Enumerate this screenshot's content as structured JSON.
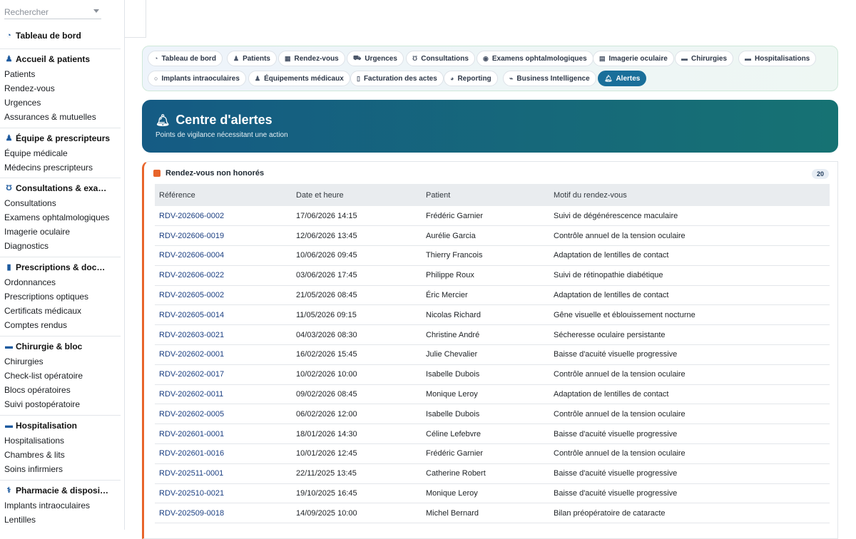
{
  "sidebar": {
    "search_placeholder": "Rechercher",
    "dashboard": "Tableau de bord",
    "sections": [
      {
        "title": "Accueil & patients",
        "icon": "user-icon",
        "items": [
          "Patients",
          "Rendez-vous",
          "Urgences",
          "Assurances & mutuelles"
        ]
      },
      {
        "title": "Équipe & prescripteurs",
        "icon": "team-icon",
        "items": [
          "Équipe médicale",
          "Médecins prescripteurs"
        ]
      },
      {
        "title": "Consultations & exa…",
        "icon": "stethoscope-icon",
        "items": [
          "Consultations",
          "Examens ophtalmologiques",
          "Imagerie oculaire",
          "Diagnostics"
        ]
      },
      {
        "title": "Prescriptions & doc…",
        "icon": "document-icon",
        "items": [
          "Ordonnances",
          "Prescriptions optiques",
          "Certificats médicaux",
          "Comptes rendus"
        ]
      },
      {
        "title": "Chirurgie & bloc",
        "icon": "bed-icon",
        "items": [
          "Chirurgies",
          "Check-list opératoire",
          "Blocs opératoires",
          "Suivi postopératoire"
        ]
      },
      {
        "title": "Hospitalisation",
        "icon": "hospital-bed-icon",
        "items": [
          "Hospitalisations",
          "Chambres & lits",
          "Soins infirmiers"
        ]
      },
      {
        "title": "Pharmacie & disposi…",
        "icon": "pharmacy-icon",
        "items": [
          "Implants intraoculaires",
          "Lentilles"
        ]
      }
    ]
  },
  "tabs": [
    {
      "label": "Tableau de bord",
      "icon": "dashboard-icon"
    },
    {
      "label": "Patients",
      "icon": "users-icon"
    },
    {
      "label": "Rendez-vous",
      "icon": "calendar-icon"
    },
    {
      "label": "Urgences",
      "icon": "ambulance-icon"
    },
    {
      "label": "Consultations",
      "icon": "stethoscope-icon"
    },
    {
      "label": "Examens ophtalmologiques",
      "icon": "eye-icon"
    },
    {
      "label": "Imagerie oculaire",
      "icon": "image-icon"
    },
    {
      "label": "Chirurgies",
      "icon": "bed-icon"
    },
    {
      "label": "Hospitalisations",
      "icon": "hospital-bed-icon"
    },
    {
      "label": "Implants intraoculaires",
      "icon": "circle-icon"
    },
    {
      "label": "Équipements médicaux",
      "icon": "equipment-icon"
    },
    {
      "label": "Facturation des actes",
      "icon": "invoice-icon"
    },
    {
      "label": "Reporting",
      "icon": "pie-chart-icon"
    },
    {
      "label": "Business Intelligence",
      "icon": "line-chart-icon"
    },
    {
      "label": "Alertes",
      "icon": "bell-icon",
      "active": true
    }
  ],
  "hero": {
    "title": "Centre d'alertes",
    "subtitle": "Points de vigilance nécessitant une action"
  },
  "card": {
    "title": "Rendez-vous non honorés",
    "count": "20",
    "accent": "#e8642a",
    "columns": [
      "Référence",
      "Date et heure",
      "Patient",
      "Motif du rendez-vous"
    ],
    "rows": [
      [
        "RDV-202606-0002",
        "17/06/2026 14:15",
        "Frédéric Garnier",
        "Suivi de dégénérescence maculaire"
      ],
      [
        "RDV-202606-0019",
        "12/06/2026 13:45",
        "Aurélie Garcia",
        "Contrôle annuel de la tension oculaire"
      ],
      [
        "RDV-202606-0004",
        "10/06/2026 09:45",
        "Thierry Francois",
        "Adaptation de lentilles de contact"
      ],
      [
        "RDV-202606-0022",
        "03/06/2026 17:45",
        "Philippe Roux",
        "Suivi de rétinopathie diabétique"
      ],
      [
        "RDV-202605-0002",
        "21/05/2026 08:45",
        "Éric Mercier",
        "Adaptation de lentilles de contact"
      ],
      [
        "RDV-202605-0014",
        "11/05/2026 09:15",
        "Nicolas Richard",
        "Gêne visuelle et éblouissement nocturne"
      ],
      [
        "RDV-202603-0021",
        "04/03/2026 08:30",
        "Christine André",
        "Sécheresse oculaire persistante"
      ],
      [
        "RDV-202602-0001",
        "16/02/2026 15:45",
        "Julie Chevalier",
        "Baisse d'acuité visuelle progressive"
      ],
      [
        "RDV-202602-0017",
        "10/02/2026 10:00",
        "Isabelle Dubois",
        "Contrôle annuel de la tension oculaire"
      ],
      [
        "RDV-202602-0011",
        "09/02/2026 08:45",
        "Monique Leroy",
        "Adaptation de lentilles de contact"
      ],
      [
        "RDV-202602-0005",
        "06/02/2026 12:00",
        "Isabelle Dubois",
        "Contrôle annuel de la tension oculaire"
      ],
      [
        "RDV-202601-0001",
        "18/01/2026 14:30",
        "Céline Lefebvre",
        "Baisse d'acuité visuelle progressive"
      ],
      [
        "RDV-202601-0016",
        "10/01/2026 12:45",
        "Frédéric Garnier",
        "Contrôle annuel de la tension oculaire"
      ],
      [
        "RDV-202511-0001",
        "22/11/2025 13:45",
        "Catherine Robert",
        "Baisse d'acuité visuelle progressive"
      ],
      [
        "RDV-202510-0021",
        "19/10/2025 16:45",
        "Monique Leroy",
        "Baisse d'acuité visuelle progressive"
      ],
      [
        "RDV-202509-0018",
        "14/09/2025 10:00",
        "Michel Bernard",
        "Bilan préopératoire de cataracte"
      ]
    ]
  }
}
